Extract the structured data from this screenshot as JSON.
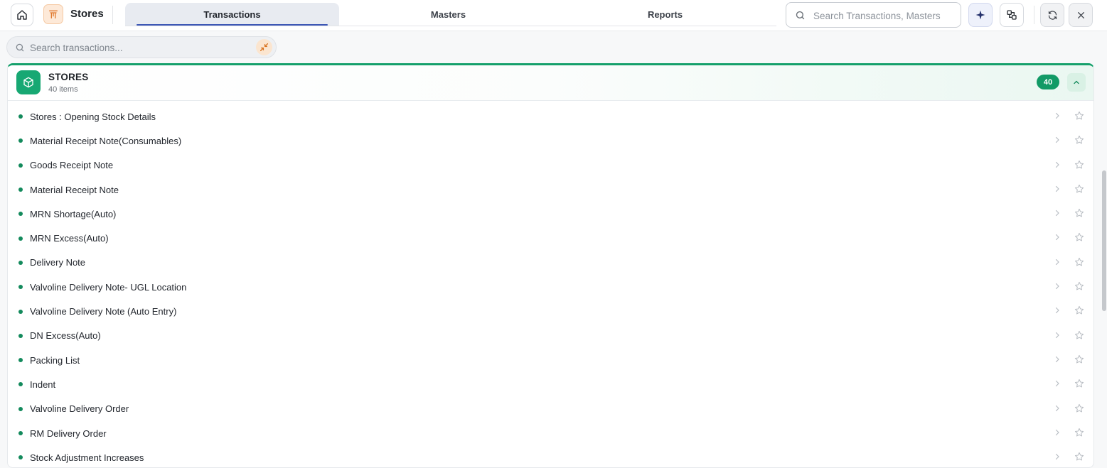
{
  "app": {
    "title": "Stores"
  },
  "tabs": [
    {
      "label": "Transactions",
      "active": true
    },
    {
      "label": "Masters",
      "active": false
    },
    {
      "label": "Reports",
      "active": false
    }
  ],
  "top_search": {
    "placeholder": "Search Transactions, Masters"
  },
  "sub_search": {
    "placeholder": "Search transactions..."
  },
  "panel": {
    "title": "STORES",
    "subtitle": "40 items",
    "count": "40",
    "accent": "#15a06b"
  },
  "items": [
    {
      "label": "Stores : Opening Stock Details"
    },
    {
      "label": "Material Receipt Note(Consumables)"
    },
    {
      "label": "Goods Receipt Note"
    },
    {
      "label": "Material Receipt Note"
    },
    {
      "label": "MRN Shortage(Auto)"
    },
    {
      "label": "MRN Excess(Auto)"
    },
    {
      "label": "Delivery Note"
    },
    {
      "label": "Valvoline Delivery Note- UGL Location"
    },
    {
      "label": "Valvoline Delivery Note (Auto Entry)"
    },
    {
      "label": "DN Excess(Auto)"
    },
    {
      "label": "Packing List"
    },
    {
      "label": "Indent"
    },
    {
      "label": "Valvoline Delivery Order"
    },
    {
      "label": "RM Delivery Order"
    },
    {
      "label": "Stock Adjustment Increases"
    }
  ]
}
